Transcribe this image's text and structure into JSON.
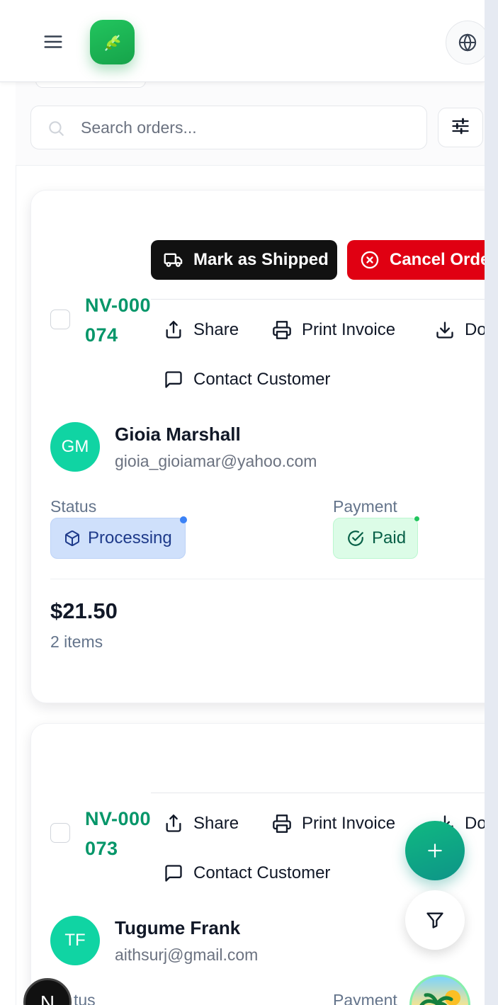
{
  "search": {
    "placeholder": "Search orders..."
  },
  "orders": [
    {
      "actions": {
        "ship_label": "Mark as Shipped",
        "cancel_label": "Cancel Orde"
      },
      "id": "NV-000074",
      "menu": {
        "share": "Share",
        "print": "Print Invoice",
        "download": "Do",
        "contact": "Contact Customer"
      },
      "customer": {
        "initials": "GM",
        "name": "Gioia Marshall",
        "email": "gioia_gioiamar@yahoo.com"
      },
      "status_label": "Status",
      "status": "Processing",
      "payment_label": "Payment",
      "payment": "Paid",
      "total": "$21.50",
      "items": "2 items"
    },
    {
      "id": "NV-000073",
      "menu": {
        "share": "Share",
        "print": "Print Invoice",
        "download": "Do",
        "contact": "Contact Customer"
      },
      "customer": {
        "initials": "TF",
        "name": "Tugume Frank",
        "email": "aithsurj@gmail.com"
      },
      "status_label": "tus",
      "payment_label": "Payment"
    }
  ],
  "dev_badge": {
    "letter": "N"
  },
  "colors": {
    "brand_green": "#16a34a",
    "order_id_green": "#059669",
    "ship_button": "#111111",
    "cancel_button": "#e00012",
    "processing_bg": "#cfe0fb",
    "paid_bg": "#dcfce7",
    "avatar_teal": "#10d4a3",
    "fab_teal": "#0d9488"
  },
  "icons": [
    "menu-icon",
    "leaf-logo-icon",
    "globe-icon",
    "search-icon",
    "sliders-icon",
    "truck-icon",
    "x-circle-icon",
    "share-icon",
    "printer-icon",
    "download-icon",
    "message-square-icon",
    "package-icon",
    "check-circle-icon",
    "plus-icon",
    "filter-icon"
  ]
}
